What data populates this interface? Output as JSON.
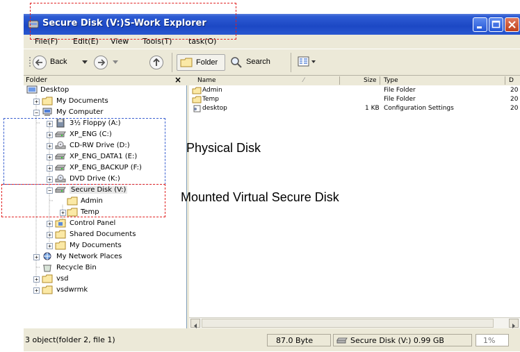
{
  "window": {
    "title": "Secure Disk (V:)S-Work Explorer"
  },
  "menu": [
    "File(F)",
    "Edit(E)",
    "View",
    "Tools(T)",
    "task(O)"
  ],
  "toolbar": {
    "back_label": "Back",
    "folder_label": "Folder",
    "search_label": "Search"
  },
  "tree_panel": {
    "header": "Folder",
    "close": "×",
    "nodes": [
      {
        "label": "Desktop",
        "icon": "desktop-icon"
      },
      {
        "label": "My Documents",
        "icon": "folder-icon"
      },
      {
        "label": "My Computer",
        "icon": "computer-icon"
      },
      {
        "label": "3½ Floppy (A:)",
        "icon": "floppy-icon"
      },
      {
        "label": "XP_ENG (C:)",
        "icon": "drive-icon"
      },
      {
        "label": "CD-RW Drive (D:)",
        "icon": "cd-drive-icon"
      },
      {
        "label": "XP_ENG_DATA1 (E:)",
        "icon": "drive-icon"
      },
      {
        "label": "XP_ENG_BACKUP (F:)",
        "icon": "drive-icon"
      },
      {
        "label": "DVD Drive (K:)",
        "icon": "dvd-drive-icon"
      },
      {
        "label": "Secure Disk (V:)",
        "icon": "drive-icon"
      },
      {
        "label": "Admin",
        "icon": "folder-icon"
      },
      {
        "label": "Temp",
        "icon": "folder-icon"
      },
      {
        "label": "Control Panel",
        "icon": "control-panel-icon"
      },
      {
        "label": "Shared Documents",
        "icon": "folder-icon"
      },
      {
        "label": "My Documents",
        "icon": "folder-icon"
      },
      {
        "label": "My Network Places",
        "icon": "network-icon"
      },
      {
        "label": "Recycle Bin",
        "icon": "recycle-bin-icon"
      },
      {
        "label": "vsd",
        "icon": "folder-icon"
      },
      {
        "label": "vsdwrmk",
        "icon": "folder-icon"
      }
    ]
  },
  "file_list": {
    "columns": [
      "Name",
      "Size",
      "Type",
      "D"
    ],
    "rows": [
      {
        "name": "Admin",
        "size": "",
        "type": "File Folder",
        "date": "20"
      },
      {
        "name": "Temp",
        "size": "",
        "type": "File Folder",
        "date": "20"
      },
      {
        "name": "desktop",
        "size": "1 KB",
        "type": "Configuration Settings",
        "date": "20"
      }
    ]
  },
  "status": {
    "objects": "3 object(folder 2, file 1)",
    "size": "87.0 Byte",
    "disk": "Secure Disk (V:) 0.99 GB",
    "percent": "1%"
  },
  "annotations": {
    "physical": "Physical Disk",
    "mounted": "Mounted Virtual Secure Disk"
  },
  "colors": {
    "titlebar": "#2d5bd3",
    "annotation_red": "#e02020",
    "annotation_blue": "#3a60d0"
  }
}
